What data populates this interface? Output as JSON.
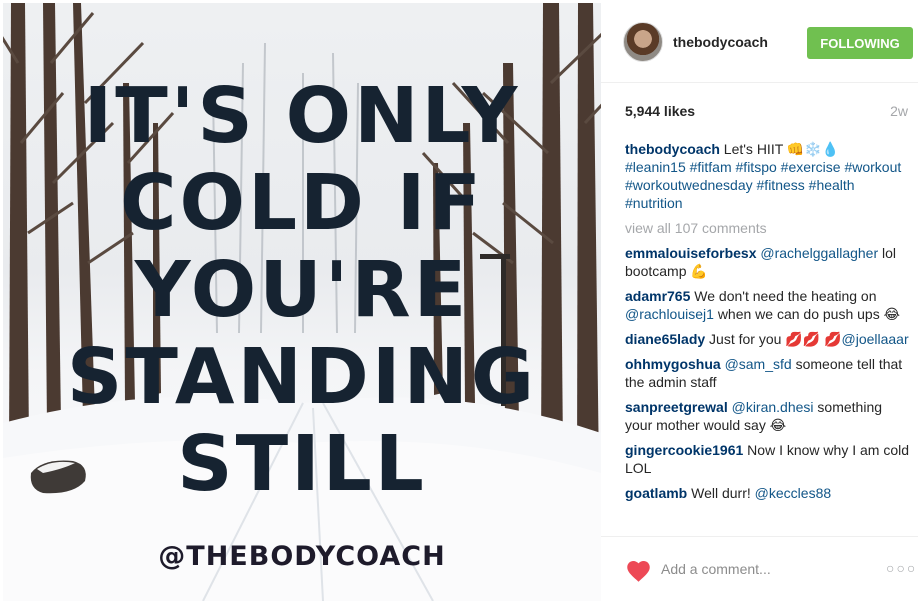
{
  "post": {
    "image_quote_lines": [
      "IT'S ONLY",
      "COLD IF",
      "YOU'RE",
      "STANDING",
      "STILL"
    ],
    "image_handle": "@THEBODYCOACH"
  },
  "header": {
    "username": "thebodycoach",
    "follow_label": "FOLLOWING",
    "follow_color": "#70c050"
  },
  "stats": {
    "likes": "5,944 likes",
    "age": "2w"
  },
  "caption": {
    "user": "thebodycoach",
    "text": "Let's HIIT 👊❄️💧",
    "hashtags": "#leanin15 #fitfam #fitspo #exercise #workout #workoutwednesday #fitness #health #nutrition"
  },
  "view_all": "view all 107 comments",
  "comments": [
    {
      "user": "emmalouiseforbesx",
      "mention": "@rachelggallagher",
      "text": "lol bootcamp 💪"
    },
    {
      "user": "adamr765",
      "text_before": "We don't need the heating on",
      "mention": "@rachlouisej1",
      "text_after": "when we can do push ups 😂"
    },
    {
      "user": "diane65lady",
      "text_before": "Just for you 💋💋",
      "mention": "💋@joellaaar",
      "text_after": ""
    },
    {
      "user": "ohhmygoshua",
      "mention": "@sam_sfd",
      "text": "someone tell that the admin staff"
    },
    {
      "user": "sanpreetgrewal",
      "mention": "@kiran.dhesi",
      "text": "something your mother would say 😂"
    },
    {
      "user": "gingercookie1961",
      "text": "Now I know why I am cold LOL"
    },
    {
      "user": "goatlamb",
      "text": "Well durr!",
      "mention": "@keccles88"
    }
  ],
  "footer": {
    "comment_placeholder": "Add a comment...",
    "more_label": "○○○",
    "heart_color": "#ed4956"
  },
  "icons": {
    "like": "heart-icon",
    "more": "more-options-icon"
  }
}
